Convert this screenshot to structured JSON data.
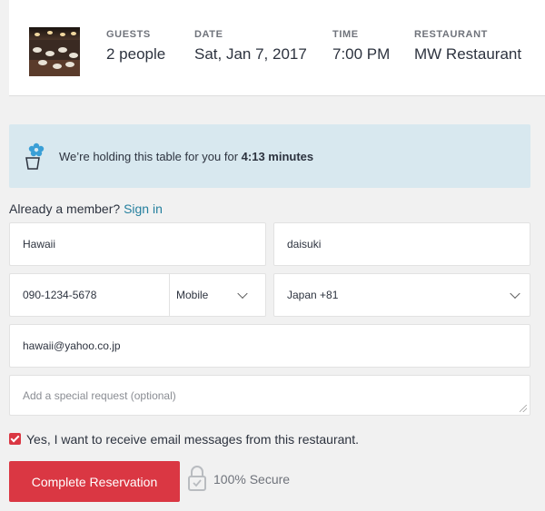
{
  "summary": {
    "image_alt": "restaurant-interior-photo",
    "guests": {
      "label": "GUESTS",
      "value": "2 people"
    },
    "date": {
      "label": "DATE",
      "value": "Sat, Jan 7, 2017"
    },
    "time": {
      "label": "TIME",
      "value": "7:00 PM"
    },
    "restaurant": {
      "label": "RESTAURANT",
      "value": "MW Restaurant"
    }
  },
  "hold": {
    "text": "We’re holding this table for you for ",
    "timer": "4:13 minutes"
  },
  "member": {
    "prompt": "Already a member? ",
    "link": "Sign in"
  },
  "form": {
    "first_name": "Hawaii",
    "last_name": "daisuki",
    "phone": "090-1234-5678",
    "phone_type": "Mobile",
    "country_code": "Japan +81",
    "email": "hawaii@yahoo.co.jp",
    "special_request_placeholder": "Add a special request (optional)"
  },
  "email_optin": {
    "checked": true,
    "label": "Yes, I want to receive email messages from this restaurant."
  },
  "submit": {
    "label": "Complete Reservation"
  },
  "secure": {
    "label": "100% Secure"
  },
  "colors": {
    "accent": "#da3743",
    "link": "#247f9e",
    "banner": "#d8e8ef"
  }
}
